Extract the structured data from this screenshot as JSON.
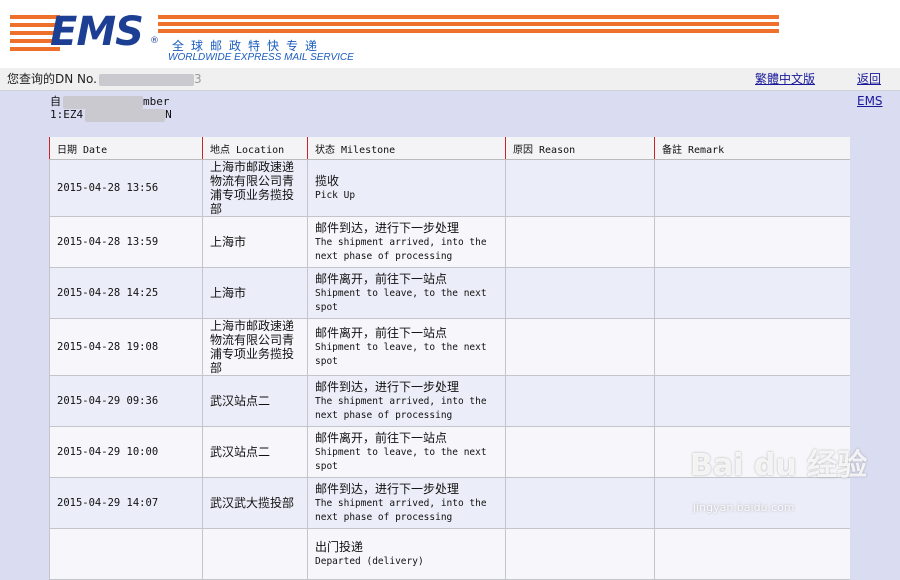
{
  "logo": {
    "brand": "EMS",
    "reg_mark": "®",
    "cn_tagline": "全球邮政特快专递",
    "en_tagline": "WORLDWIDE EXPRESS MAIL SERVICE"
  },
  "infobar": {
    "query_label": "您查询的DN No.",
    "query_tail": "3",
    "link_traditional": "繁體中文版",
    "link_back": "返回EMS"
  },
  "subheader": {
    "line1_suffix": "mber",
    "line1_prefix": "自",
    "line2_prefix": "1:EZ4",
    "line2_suffix": "N"
  },
  "table": {
    "headers": [
      "日期 Date",
      "地点 Location",
      "状态 Milestone",
      "原因 Reason",
      "备註 Remark"
    ],
    "rows": [
      {
        "date": "2015-04-28 13:56",
        "location": "上海市邮政速递物流有限公司青浦专项业务揽投部",
        "milestone_cn": "揽收",
        "milestone_en": "Pick Up",
        "reason": "",
        "remark": ""
      },
      {
        "date": "2015-04-28 13:59",
        "location": "上海市",
        "milestone_cn": "邮件到达，进行下一步处理",
        "milestone_en": "The shipment arrived, into the next phase of processing",
        "reason": "",
        "remark": ""
      },
      {
        "date": "2015-04-28 14:25",
        "location": "上海市",
        "milestone_cn": "邮件离开，前往下一站点",
        "milestone_en": "Shipment to leave, to the next spot",
        "reason": "",
        "remark": ""
      },
      {
        "date": "2015-04-28 19:08",
        "location": "上海市邮政速递物流有限公司青浦专项业务揽投部",
        "milestone_cn": "邮件离开，前往下一站点",
        "milestone_en": "Shipment to leave, to the next spot",
        "reason": "",
        "remark": ""
      },
      {
        "date": "2015-04-29 09:36",
        "location": "武汉站点二",
        "milestone_cn": "邮件到达，进行下一步处理",
        "milestone_en": "The shipment arrived, into the next phase of processing",
        "reason": "",
        "remark": ""
      },
      {
        "date": "2015-04-29 10:00",
        "location": "武汉站点二",
        "milestone_cn": "邮件离开，前往下一站点",
        "milestone_en": "Shipment to leave, to the next spot",
        "reason": "",
        "remark": ""
      },
      {
        "date": "2015-04-29 14:07",
        "location": "武汉武大揽投部",
        "milestone_cn": "邮件到达，进行下一步处理",
        "milestone_en": "The shipment arrived, into the next phase of processing",
        "reason": "",
        "remark": ""
      },
      {
        "date": "",
        "location": "",
        "milestone_cn": "出门投递",
        "milestone_en": "Departed (delivery)",
        "reason": "",
        "remark": ""
      }
    ]
  },
  "watermark": {
    "text": "Bai du 经验",
    "url": "jingyan.baidu.com"
  },
  "colors": {
    "accent_orange": "#ef6f2d",
    "brand_blue": "#1c3f93",
    "header_red_rule": "#c8252b",
    "page_bg": "#dadcf2"
  }
}
